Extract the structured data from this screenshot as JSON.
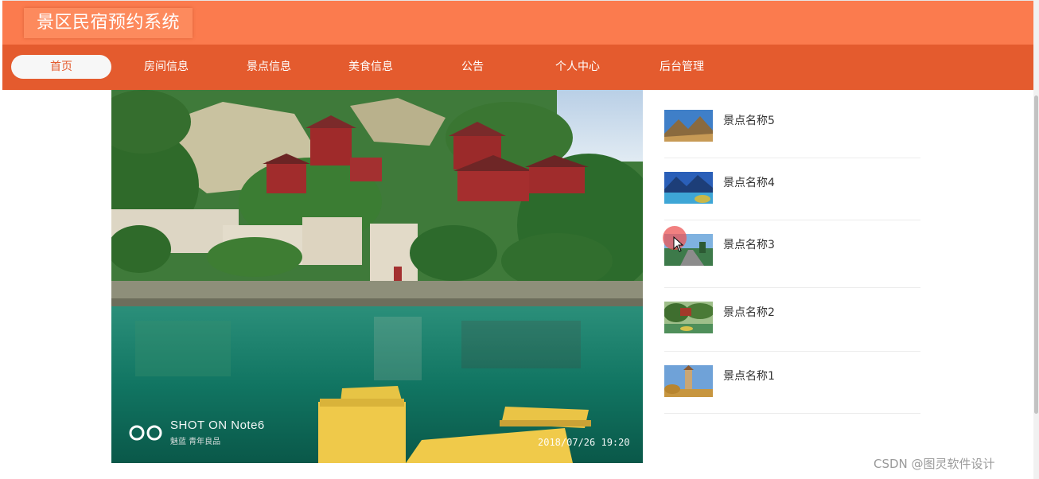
{
  "header": {
    "site_title": "景区民宿预约系统"
  },
  "nav": {
    "items": [
      {
        "label": "首页"
      },
      {
        "label": "房间信息"
      },
      {
        "label": "景点信息"
      },
      {
        "label": "美食信息"
      },
      {
        "label": "公告"
      },
      {
        "label": "个人中心"
      },
      {
        "label": "后台管理"
      }
    ],
    "active_index": 0
  },
  "banner": {
    "watermark_title": "SHOT ON Note6",
    "watermark_sub": "魅蓝 青年良品",
    "photo_timestamp": "2018/07/26  19:20"
  },
  "spots": {
    "items": [
      {
        "name": "景点名称5",
        "thumb_icon": "mountain-photo"
      },
      {
        "name": "景点名称4",
        "thumb_icon": "lake-photo"
      },
      {
        "name": "景点名称3",
        "thumb_icon": "road-photo"
      },
      {
        "name": "景点名称2",
        "thumb_icon": "park-photo"
      },
      {
        "name": "景点名称1",
        "thumb_icon": "tower-photo"
      }
    ]
  },
  "footer": {
    "watermark": "CSDN @图灵软件设计"
  },
  "colors": {
    "topbar": "#fb7b4e",
    "navbar": "#e45b2e",
    "active_pill": "#f7f7f7",
    "text_dark": "#333333"
  }
}
